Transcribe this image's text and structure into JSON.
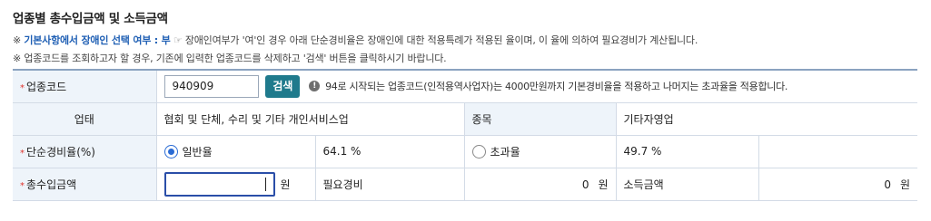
{
  "header": {
    "title": "업종별 총수입금액 및 소득금액"
  },
  "notes": {
    "line1_prefix": "※ ",
    "line1_link": "기본사항에서 장애인 선택 여부 : 부",
    "line1_hand": " ☞ ",
    "line1_text": "장애인여부가 '여'인 경우 아래 단순경비율은 장애인에 대한 적용특례가 적용된 율이며, 이 율에 의하여 필요경비가 계산됩니다.",
    "line2": "※ 업종코드를 조회하고자 할 경우, 기존에 입력한 업종코드를 삭제하고 '검색' 버튼을 클릭하시기 바랍니다."
  },
  "form": {
    "required_mark": "*",
    "code_label": "업종코드",
    "code_value": "940909",
    "search_button": "검색",
    "info_glyph": "!",
    "info_text": "94로 시작되는 업종코드(인적용역사업자)는 4000만원까지 기본경비율을 적용하고 나머지는 초과율을 적용합니다.",
    "category_label": "업태",
    "category_value": "협회 및 단체, 수리 및 기타 개인서비스업",
    "item_label": "종목",
    "item_value": "기타자영업",
    "rate_label": "단순경비율(%)",
    "rate_general_label": "일반율",
    "rate_general_value": "64.1 %",
    "rate_excess_label": "초과율",
    "rate_excess_value": "49.7 %",
    "revenue_label": "총수입금액",
    "revenue_unit": "원",
    "expense_label": "필요경비",
    "expense_value": "0",
    "expense_unit": "원",
    "income_label": "소득금액",
    "income_value": "0",
    "income_unit": "원"
  }
}
